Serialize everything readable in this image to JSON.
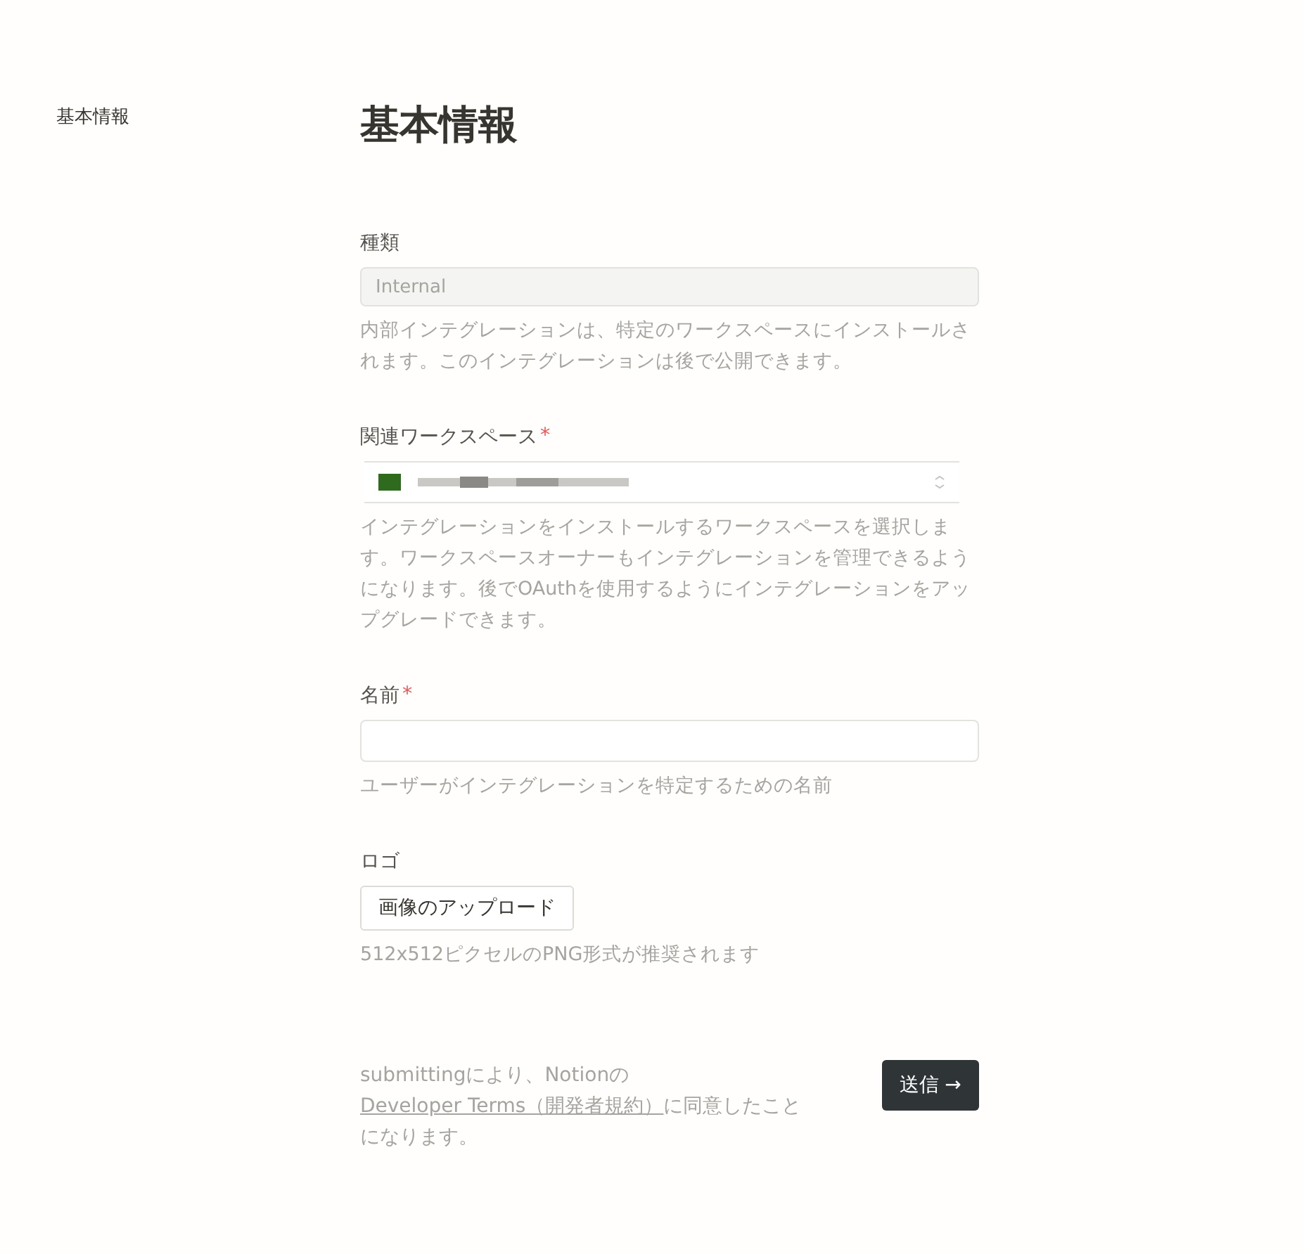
{
  "sidebar": {
    "items": [
      {
        "label": "基本情報"
      }
    ]
  },
  "title": "基本情報",
  "fields": [
    {
      "kind": "readonly",
      "label": "種類",
      "value": "Internal",
      "description": "内部インテグレーションは、特定のワークスペースにインストールされます。このインテグレーションは後で公開できます。"
    },
    {
      "kind": "select",
      "label": "関連ワークスペース",
      "required_mark": "*",
      "description": "インテグレーションをインストールするワークスペースを選択します。ワークスペースオーナーもインテグレーションを管理できるようになります。後でOAuthを使用するようにインテグレーションをアップグレードできます。"
    },
    {
      "kind": "text",
      "label": "名前",
      "required_mark": "*",
      "description": "ユーザーがインテグレーションを特定するための名前"
    },
    {
      "kind": "upload",
      "label": "ロゴ",
      "button": "画像のアップロード",
      "description": "512x512ピクセルのPNG形式が推奨されます"
    }
  ],
  "footer": {
    "before": "submittingにより、Notionの",
    "link": "Developer Terms（開発者規約）",
    "after": "に同意したことになります。"
  },
  "submit": {
    "label": "送信",
    "icon": "→"
  }
}
